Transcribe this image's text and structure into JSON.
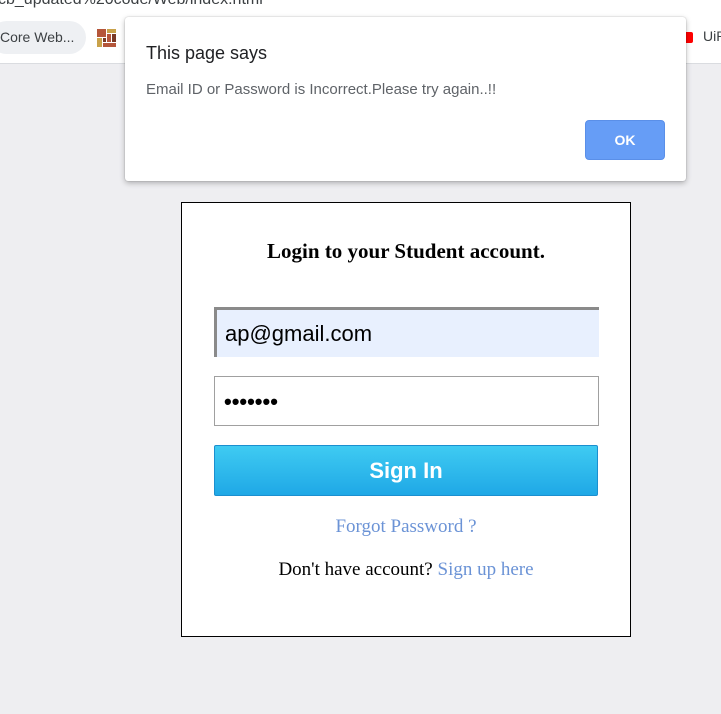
{
  "browser": {
    "url_fragment": "cb_updated%20code/Web/index.html",
    "bookmarks": {
      "left_label": "Core Web...",
      "right_label": "UiP"
    }
  },
  "alert": {
    "title": "This page says",
    "message": "Email ID or Password is Incorrect.Please try again..!!",
    "ok_label": "OK"
  },
  "login": {
    "heading": "Login to your Student account.",
    "email_value": "ap@gmail.com",
    "password_mask": "•••••••",
    "signin_label": "Sign In",
    "forgot_label": "Forgot Password ?",
    "no_account_text": "Don't have account?",
    "signup_label": "Sign up here"
  },
  "colors": {
    "ok_button": "#669df6",
    "signin_button": "#29b6ea",
    "link": "#6b93d6",
    "email_autofill_bg": "#e8f0fe"
  }
}
